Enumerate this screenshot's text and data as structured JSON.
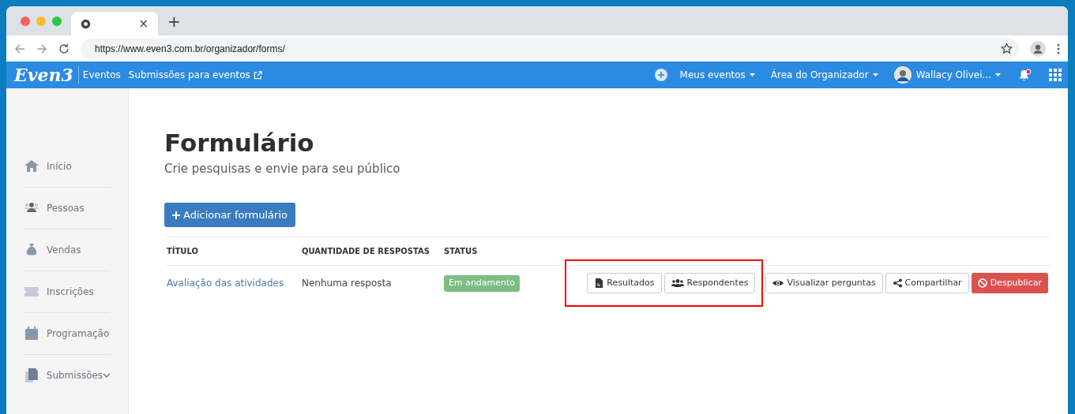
{
  "browser": {
    "tab_close": "×",
    "new_tab": "+",
    "url": "https://www.even3.com.br/organizador/forms/"
  },
  "navbar": {
    "logo": "Even3",
    "section": "Eventos",
    "links": [
      {
        "label": "Submissões para eventos",
        "external": true
      }
    ],
    "menus": [
      {
        "label": "Meus eventos"
      },
      {
        "label": "Área do Organizador"
      }
    ],
    "user": "Wallacy Olivei...",
    "notification": true
  },
  "sidebar": {
    "items": [
      {
        "label": "Início",
        "kind": "link"
      },
      {
        "label": "Pessoas",
        "kind": "link"
      },
      {
        "label": "Vendas",
        "kind": "link"
      },
      {
        "label": "Inscrições",
        "kind": "link"
      },
      {
        "label": "Programação",
        "kind": "link"
      },
      {
        "label": "Submissões",
        "kind": "group"
      }
    ]
  },
  "page": {
    "title": "Formulário",
    "subtitle": "Crie pesquisas e envie para seu público",
    "add_button": "Adicionar formulário"
  },
  "table": {
    "columns": [
      "TÍTULO",
      "QUANTIDADE DE RESPOSTAS",
      "STATUS"
    ],
    "rows": [
      {
        "title": "Avaliação das atividades",
        "responses": "Nenhuma resposta",
        "status": "Em andamento",
        "actions": [
          {
            "label": "Resultados",
            "kind": "results",
            "highlighted": true
          },
          {
            "label": "Respondentes",
            "kind": "respondents",
            "highlighted": true
          },
          {
            "label": "Visualizar perguntas",
            "kind": "view",
            "highlighted": false
          },
          {
            "label": "Compartilhar",
            "kind": "share",
            "highlighted": false
          },
          {
            "label": "Despublicar",
            "kind": "unpublish",
            "highlighted": false
          }
        ]
      }
    ]
  }
}
